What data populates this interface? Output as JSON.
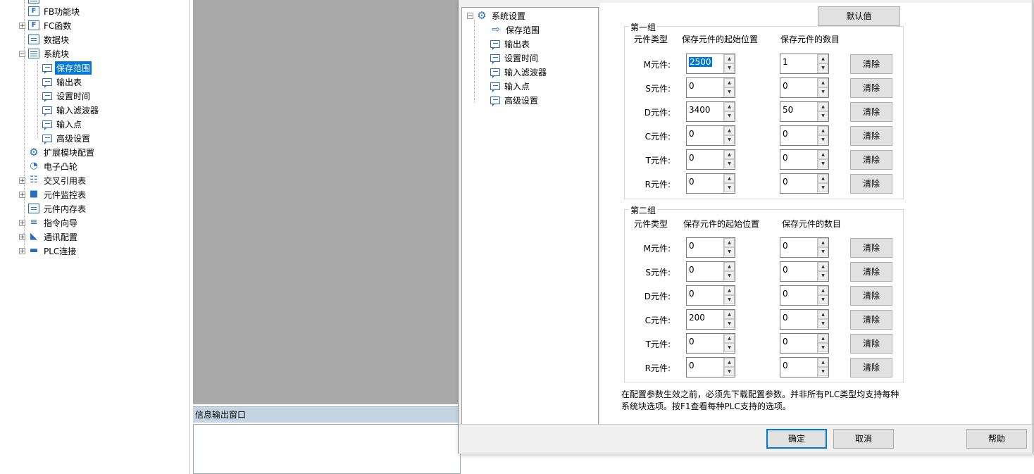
{
  "project_tree": {
    "items": [
      {
        "label": "FB功能块",
        "icon": "fb-block-icon"
      },
      {
        "label": "FC函数",
        "icon": "fc-function-icon"
      },
      {
        "label": "数据块",
        "icon": "data-block-icon"
      },
      {
        "label": "系统块",
        "icon": "system-block-icon"
      },
      {
        "label": "保存范围",
        "icon": "comment-icon"
      },
      {
        "label": "输出表",
        "icon": "comment-icon"
      },
      {
        "label": "设置时间",
        "icon": "comment-icon"
      },
      {
        "label": "输入滤波器",
        "icon": "comment-icon"
      },
      {
        "label": "输入点",
        "icon": "comment-icon"
      },
      {
        "label": "高级设置",
        "icon": "comment-icon"
      },
      {
        "label": "扩展模块配置",
        "icon": "gear-icon"
      },
      {
        "label": "电子凸轮",
        "icon": "cam-icon"
      },
      {
        "label": "交叉引用表",
        "icon": "table-icon"
      },
      {
        "label": "元件监控表",
        "icon": "monitor-icon"
      },
      {
        "label": "元件内存表",
        "icon": "memory-table-icon"
      },
      {
        "label": "指令向导",
        "icon": "list-icon"
      },
      {
        "label": "通讯配置",
        "icon": "satellite-icon"
      },
      {
        "label": "PLC连接",
        "icon": "plug-icon"
      }
    ],
    "selected": "保存范围"
  },
  "info_window": {
    "title": "信息输出窗口"
  },
  "dialog": {
    "tree": {
      "root": "系统设置",
      "items": [
        "保存范围",
        "输出表",
        "设置时间",
        "输入滤波器",
        "输入点",
        "高级设置"
      ]
    },
    "default_button": "默认值",
    "group1": {
      "title": "第一组",
      "col_type": "元件类型",
      "col_start": "保存元件的起始位置",
      "col_count": "保存元件的数目",
      "rows": [
        {
          "label": "M元件:",
          "start": "2500",
          "count": "1",
          "clear": "清除"
        },
        {
          "label": "S元件:",
          "start": "0",
          "count": "0",
          "clear": "清除"
        },
        {
          "label": "D元件:",
          "start": "3400",
          "count": "50",
          "clear": "清除"
        },
        {
          "label": "C元件:",
          "start": "0",
          "count": "0",
          "clear": "清除"
        },
        {
          "label": "T元件:",
          "start": "0",
          "count": "0",
          "clear": "清除"
        },
        {
          "label": "R元件:",
          "start": "0",
          "count": "0",
          "clear": "清除"
        }
      ]
    },
    "group2": {
      "title": "第二组",
      "col_type": "元件类型",
      "col_start": "保存元件的起始位置",
      "col_count": "保存元件的数目",
      "rows": [
        {
          "label": "M元件:",
          "start": "0",
          "count": "0",
          "clear": "清除"
        },
        {
          "label": "S元件:",
          "start": "0",
          "count": "0",
          "clear": "清除"
        },
        {
          "label": "D元件:",
          "start": "0",
          "count": "0",
          "clear": "清除"
        },
        {
          "label": "C元件:",
          "start": "200",
          "count": "0",
          "clear": "清除"
        },
        {
          "label": "T元件:",
          "start": "0",
          "count": "0",
          "clear": "清除"
        },
        {
          "label": "R元件:",
          "start": "0",
          "count": "0",
          "clear": "清除"
        }
      ]
    },
    "note_line1": "在配置参数生效之前，必须先下载配置参数。并非所有PLC类型均支持每种",
    "note_line2": "系统块选项。按F1查看每种PLC支持的选项。",
    "ok_button": "确定",
    "cancel_button": "取消",
    "help_button": "帮助"
  }
}
